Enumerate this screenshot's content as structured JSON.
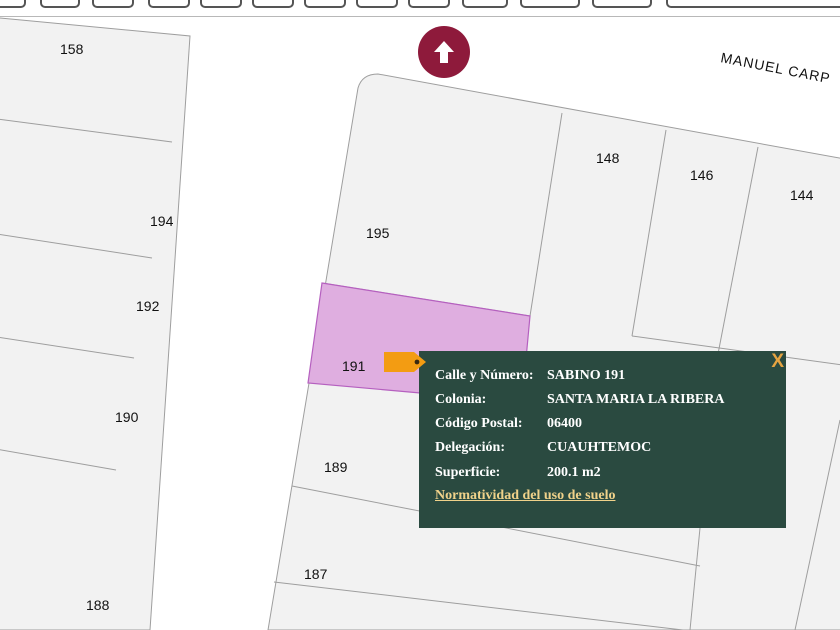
{
  "toolbar": {
    "buttons": [
      "pan-tool",
      "zoom-tool",
      "zoom-in-tool",
      "zoom-out-tool",
      "identify-tool",
      "measure-tool",
      "select-tool",
      "select-area-tool",
      "clear-select-tool",
      "ruler-tool",
      "print-tool",
      "layers-tool",
      "search-tool"
    ]
  },
  "map": {
    "street_name": "MANUEL CARP",
    "lots": [
      "158",
      "194",
      "192",
      "190",
      "188",
      "195",
      "191",
      "189",
      "187",
      "148",
      "146",
      "144"
    ],
    "north_arrow_icon": "north-arrow-icon",
    "colors": {
      "selected_lot": "#dfaee0",
      "selected_lot_border": "#b560bf",
      "lot_fill": "#f2f2f2",
      "lot_line": "#9e9e9e"
    }
  },
  "popup": {
    "close_label": "X",
    "rows": [
      {
        "key": "Calle y Número:",
        "value": "SABINO 191"
      },
      {
        "key": "Colonia:",
        "value": "SANTA MARIA LA RIBERA"
      },
      {
        "key": "Código Postal:",
        "value": "06400"
      },
      {
        "key": "Delegación:",
        "value": "CUAUHTEMOC"
      },
      {
        "key": "Superficie:",
        "value": "200.1 m2"
      }
    ],
    "link_label": "Normatividad del uso de suelo",
    "colors": {
      "background": "#2a4a40",
      "close": "#e6a441",
      "link": "#f0d28a"
    }
  },
  "marker": {
    "icon": "tag-marker-icon",
    "color": "#f39c12"
  }
}
